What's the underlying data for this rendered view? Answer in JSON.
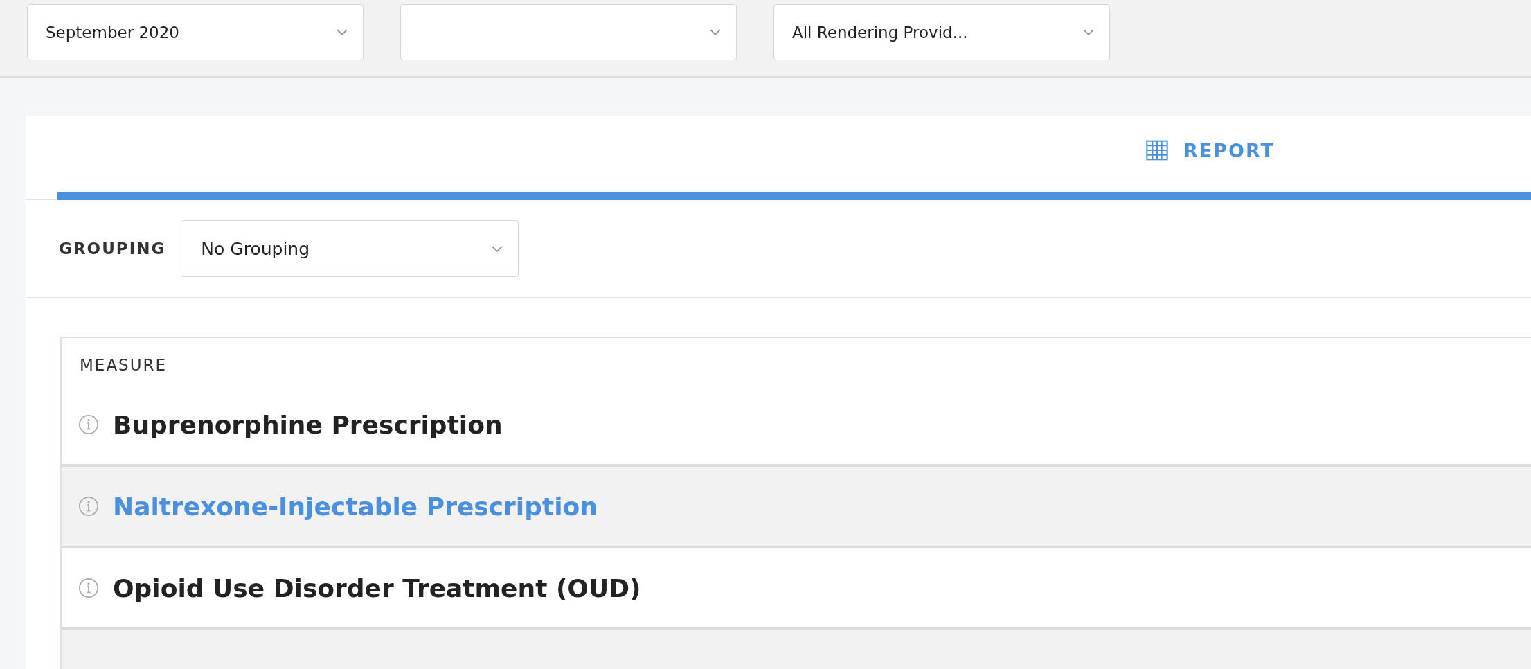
{
  "filters": [
    {
      "kind": "dropdown",
      "value": "September 2020"
    },
    {
      "kind": "dropdown"
    },
    {
      "kind": "dropdown",
      "value": "All Rendering Provid..."
    }
  ],
  "tabs": [
    {
      "label": "REPORT",
      "selected": true
    }
  ],
  "grouping": {
    "label": "GROUPING",
    "value": "No Grouping"
  },
  "table": {
    "header": "MEASURE",
    "rows": [
      {
        "name": "Buprenorphine Prescription",
        "selected": false
      },
      {
        "name": "Naltrexone-Injectable Prescription",
        "selected": true
      },
      {
        "name": "Opioid Use Disorder Treatment (OUD)",
        "selected": false
      }
    ]
  }
}
